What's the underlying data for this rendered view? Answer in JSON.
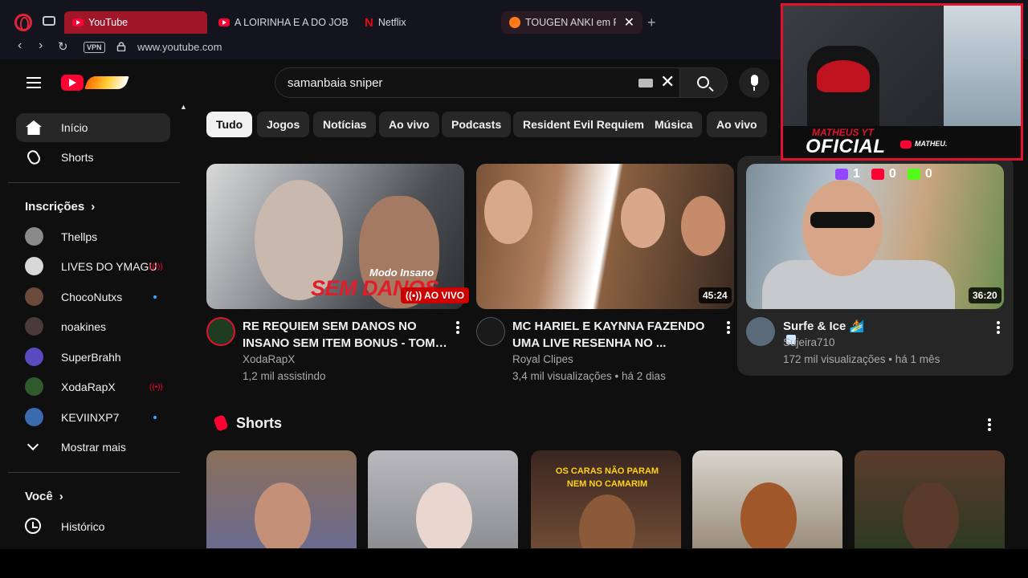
{
  "browser": {
    "tabs": [
      {
        "label": "YouTube"
      },
      {
        "label": "A LOIRINHA E A DO JOB C"
      },
      {
        "label": "Netflix"
      },
      {
        "label": "TOUGEN ANKI em Port"
      }
    ],
    "vpn_label": "VPN",
    "url": "www.youtube.com"
  },
  "search": {
    "value": "samanbaia sniper"
  },
  "sidebar": {
    "main": [
      {
        "label": "Início"
      },
      {
        "label": "Shorts"
      }
    ],
    "subscriptions_title": "Inscrições",
    "subscriptions": [
      {
        "label": "Thellps",
        "indicator": "none"
      },
      {
        "label": "LIVES DO YMAGU",
        "indicator": "live"
      },
      {
        "label": "ChocoNutxs",
        "indicator": "new"
      },
      {
        "label": "noakines",
        "indicator": "none"
      },
      {
        "label": "SuperBrahh",
        "indicator": "none"
      },
      {
        "label": "XodaRapX",
        "indicator": "live"
      },
      {
        "label": "KEVIINXP7",
        "indicator": "new"
      }
    ],
    "show_more": "Mostrar mais",
    "you_title": "Você",
    "history": "Histórico"
  },
  "chips": [
    "Tudo",
    "Jogos",
    "Notícias",
    "Ao vivo",
    "Podcasts",
    "Resident Evil Requiem",
    "Música",
    "Ao vivo"
  ],
  "videos": [
    {
      "title_line1": "RE REQUIEM SEM DANOS NO",
      "title_line2": "INSANO SEM ITEM BONUS - TOMO...",
      "channel": "XodaRapX",
      "meta": "1,2 mil assistindo",
      "badge": "AO VIVO",
      "thumb_text1": "Modo Insano",
      "thumb_text2": "SEM DANOS"
    },
    {
      "title_line1": "MC HARIEL E KAYNNA FAZENDO",
      "title_line2": "UMA LIVE RESENHA NO ...",
      "channel": "Royal Clipes",
      "meta": "3,4 mil visualizações • há 2 dias",
      "badge": "45:24"
    },
    {
      "title_line1": "Surfe & Ice 🏄",
      "channel": "Sujeira710",
      "meta": "172 mil visualizações • há 1 mês",
      "badge": "36:20"
    }
  ],
  "stream_overlay": {
    "brand_top": "MATHEUS YT",
    "brand_main": "OFICIAL",
    "handle": "MATHEU.",
    "counters": [
      {
        "platform": "twitch",
        "color": "#9146ff",
        "value": "1"
      },
      {
        "platform": "youtube",
        "color": "#ff0033",
        "value": "0"
      },
      {
        "platform": "kick",
        "color": "#53fc18",
        "value": "0"
      }
    ]
  },
  "shorts": {
    "title": "Shorts",
    "s3_caption": "OS CARAS NÃO PARAM NEM NO CAMARIM"
  },
  "colors": {
    "accent": "#ff0033",
    "background": "#0f0f0f",
    "tab_active": "#9f1628"
  }
}
